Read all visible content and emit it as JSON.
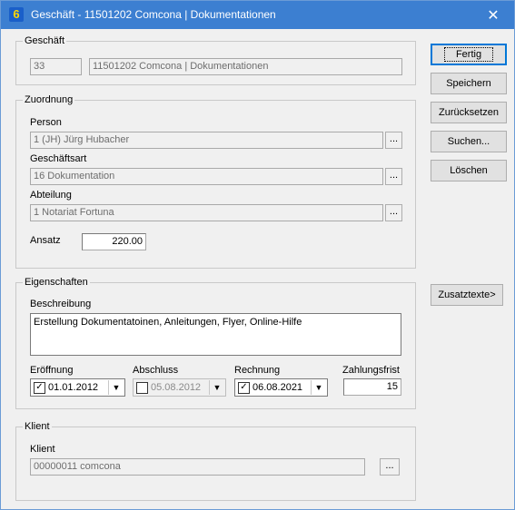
{
  "window": {
    "title": "Geschäft - 11501202  Comcona | Dokumentationen",
    "app_icon_glyph": "6",
    "close_glyph": "✕",
    "titlebar_color": "#3c7fd1"
  },
  "geschaeft": {
    "legend": "Geschäft",
    "number": "33",
    "name": "11501202  Comcona | Dokumentationen"
  },
  "zuordnung": {
    "legend": "Zuordnung",
    "person_label": "Person",
    "person_value": "1 (JH) Jürg Hubacher",
    "geschaeftsart_label": "Geschäftsart",
    "geschaeftsart_value": "16 Dokumentation",
    "abteilung_label": "Abteilung",
    "abteilung_value": "1 Notariat Fortuna",
    "ansatz_label": "Ansatz",
    "ansatz_value": "220.00",
    "browse_label": "..."
  },
  "eigenschaften": {
    "legend": "Eigenschaften",
    "beschreibung_label": "Beschreibung",
    "beschreibung_value": "Erstellung Dokumentatoinen, Anleitungen, Flyer, Online-Hilfe",
    "eroeffnung_label": "Eröffnung",
    "eroeffnung_value": "01.01.2012",
    "eroeffnung_checked": true,
    "abschluss_label": "Abschluss",
    "abschluss_value": "05.08.2012",
    "abschluss_checked": false,
    "rechnung_label": "Rechnung",
    "rechnung_value": "06.08.2021",
    "rechnung_checked": true,
    "zahlungsfrist_label": "Zahlungsfrist",
    "zahlungsfrist_value": "15",
    "check_glyph": "✓",
    "dropdown_glyph": "▼"
  },
  "klient": {
    "legend": "Klient",
    "klient_label": "Klient",
    "klient_value": "00000011  comcona",
    "browse_label": "..."
  },
  "buttons": {
    "fertig": "Fertig",
    "speichern": "Speichern",
    "zuruecksetzen": "Zurücksetzen",
    "suchen": "Suchen...",
    "loeschen": "Löschen",
    "zusatztexte": "Zusatztexte>"
  }
}
